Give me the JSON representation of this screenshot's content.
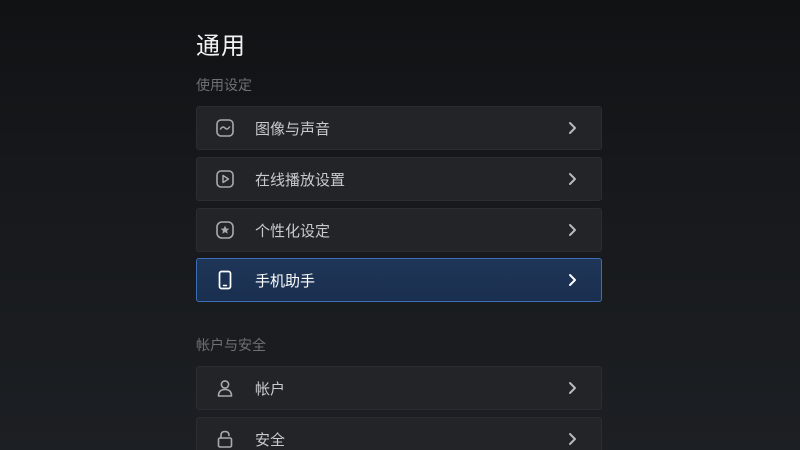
{
  "page": {
    "title": "通用"
  },
  "sections": [
    {
      "label": "使用设定",
      "items": [
        {
          "label": "图像与声音",
          "icon": "picture-sound-icon",
          "active": false
        },
        {
          "label": "在线播放设置",
          "icon": "play-icon",
          "active": false
        },
        {
          "label": "个性化设定",
          "icon": "star-icon",
          "active": false
        },
        {
          "label": "手机助手",
          "icon": "phone-icon",
          "active": true
        }
      ]
    },
    {
      "label": "帐户与安全",
      "items": [
        {
          "label": "帐户",
          "icon": "user-icon",
          "active": false
        },
        {
          "label": "安全",
          "icon": "lock-icon",
          "active": false
        }
      ]
    }
  ],
  "colors": {
    "accent_border": "#3a6fb8",
    "active_bg": "#1f3658",
    "row_bg": "#222427"
  }
}
